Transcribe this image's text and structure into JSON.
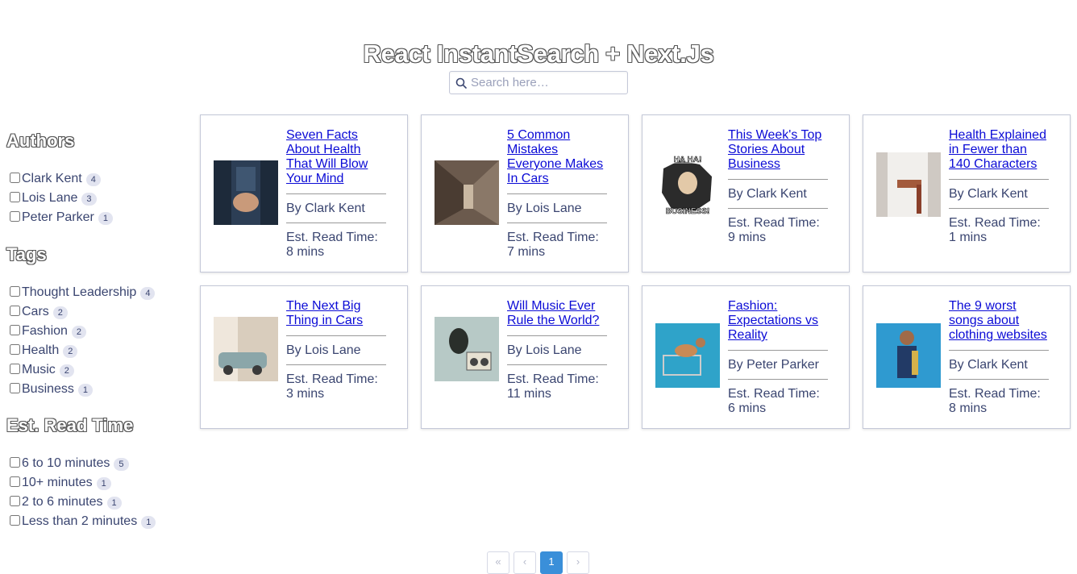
{
  "header": {
    "title": "React InstantSearch + Next.Js"
  },
  "search": {
    "placeholder": "Search here…",
    "value": ""
  },
  "facets": {
    "authors": {
      "title": "Authors",
      "items": [
        {
          "label": "Clark Kent",
          "count": "4"
        },
        {
          "label": "Lois Lane",
          "count": "3"
        },
        {
          "label": "Peter Parker",
          "count": "1"
        }
      ]
    },
    "tags": {
      "title": "Tags",
      "items": [
        {
          "label": "Thought Leadership",
          "count": "4"
        },
        {
          "label": "Cars",
          "count": "2"
        },
        {
          "label": "Fashion",
          "count": "2"
        },
        {
          "label": "Health",
          "count": "2"
        },
        {
          "label": "Music",
          "count": "2"
        },
        {
          "label": "Business",
          "count": "1"
        }
      ]
    },
    "read_time": {
      "title": "Est. Read Time",
      "items": [
        {
          "label": "6 to 10 minutes",
          "count": "5"
        },
        {
          "label": "10+ minutes",
          "count": "1"
        },
        {
          "label": "2 to 6 minutes",
          "count": "1"
        },
        {
          "label": "Less than 2 minutes",
          "count": "1"
        }
      ]
    }
  },
  "hits": [
    {
      "title": "Seven Facts About Health That Will Blow Your Mind",
      "author": "By Clark Kent",
      "read_label": "Est. Read Time:",
      "read_value": "8 mins"
    },
    {
      "title": "5 Common Mistakes Everyone Makes In Cars",
      "author": "By Lois Lane",
      "read_label": "Est. Read Time:",
      "read_value": "7 mins"
    },
    {
      "title": "This Week's Top Stories About Business",
      "author": "By Clark Kent",
      "read_label": "Est. Read Time:",
      "read_value": "9 mins"
    },
    {
      "title": "Health Explained in Fewer than 140 Characters",
      "author": "By Clark Kent",
      "read_label": "Est. Read Time:",
      "read_value": "1 mins"
    },
    {
      "title": "The Next Big Thing in Cars",
      "author": "By Lois Lane",
      "read_label": "Est. Read Time:",
      "read_value": "3 mins"
    },
    {
      "title": "Will Music Ever Rule the World?",
      "author": "By Lois Lane",
      "read_label": "Est. Read Time:",
      "read_value": "11 mins"
    },
    {
      "title": "Fashion: Expectations vs Reality",
      "author": "By Peter Parker",
      "read_label": "Est. Read Time:",
      "read_value": "6 mins"
    },
    {
      "title": "The 9 worst songs about clothing websites",
      "author": "By Clark Kent",
      "read_label": "Est. Read Time:",
      "read_value": "8 mins"
    }
  ],
  "meme_text": {
    "top": "HA HA!",
    "bottom": "BUSINESS!"
  },
  "pagination": {
    "first": "«",
    "prev": "‹",
    "current": "1",
    "next": "›"
  },
  "colors": {
    "link": "#0b0bd6",
    "active_page": "#3a8fd9",
    "text": "#3a4570"
  }
}
